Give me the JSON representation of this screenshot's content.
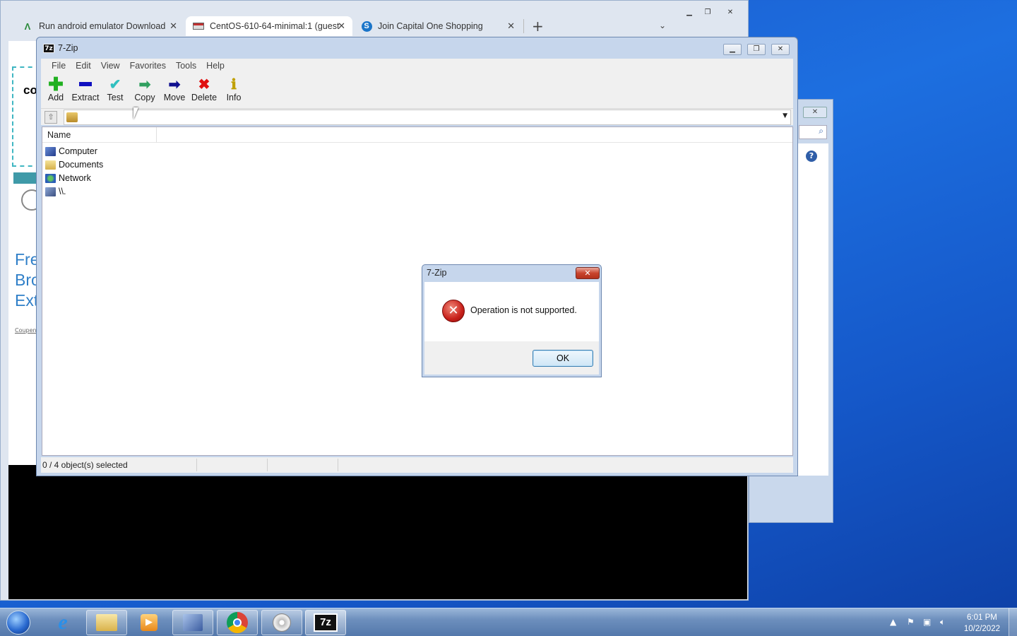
{
  "browser": {
    "tabs": [
      {
        "label": "Run android emulator Download",
        "icon": "android-a-icon"
      },
      {
        "label": "CentOS-610-64-minimal:1 (guest",
        "icon": "vm-icon"
      },
      {
        "label": "Join Capital One Shopping",
        "icon": "capital-one-icon"
      }
    ],
    "close_glyph": "✕",
    "new_tab": "+",
    "page_fragments": {
      "logo_text": "co",
      "promo_lines": [
        "Fre",
        "Bro",
        "Ext"
      ],
      "small_text": "Coupen"
    }
  },
  "zip": {
    "title": "7-Zip",
    "menu": [
      "File",
      "Edit",
      "View",
      "Favorites",
      "Tools",
      "Help"
    ],
    "toolbar": [
      {
        "label": "Add",
        "icon": "plus-icon",
        "color": "#20b020"
      },
      {
        "label": "Extract",
        "icon": "minus-icon",
        "color": "#1010c0"
      },
      {
        "label": "Test",
        "icon": "check-icon",
        "color": "#30c0c0"
      },
      {
        "label": "Copy",
        "icon": "copy-arrow-icon",
        "color": "#30a060"
      },
      {
        "label": "Move",
        "icon": "move-arrow-icon",
        "color": "#101090"
      },
      {
        "label": "Delete",
        "icon": "delete-x-icon",
        "color": "#e01010"
      },
      {
        "label": "Info",
        "icon": "info-icon",
        "color": "#c0a000"
      }
    ],
    "column_name": "Name",
    "items": [
      {
        "label": "Computer",
        "icon": "computer-icon"
      },
      {
        "label": "Documents",
        "icon": "folder-icon"
      },
      {
        "label": "Network",
        "icon": "network-icon"
      },
      {
        "label": "\\\\.",
        "icon": "device-icon"
      }
    ],
    "status": "0 / 4 object(s) selected"
  },
  "dialog": {
    "title": "7-Zip",
    "message": "Operation is not supported.",
    "ok_label": "OK"
  },
  "taskbar": {
    "time": "6:01 PM",
    "date": "10/2/2022",
    "zip_label": "7z"
  }
}
